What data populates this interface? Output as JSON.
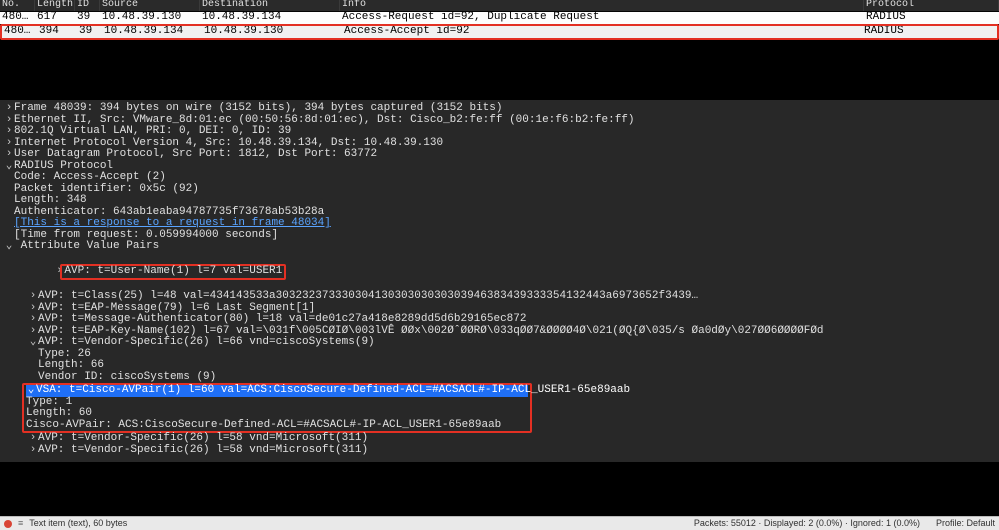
{
  "columns": {
    "no": "No.",
    "length": "Length",
    "id": "ID",
    "source": "Source",
    "destination": "Destination",
    "info": "Info",
    "protocol": "Protocol"
  },
  "packets": [
    {
      "no": "480…",
      "length": "617",
      "id": "39",
      "source": "10.48.39.130",
      "destination": "10.48.39.134",
      "info": "Access-Request id=92, Duplicate Request",
      "protocol": "RADIUS"
    },
    {
      "no": "480…",
      "length": "394",
      "id": "39",
      "source": "10.48.39.134",
      "destination": "10.48.39.130",
      "info": "Access-Accept id=92",
      "protocol": "RADIUS"
    }
  ],
  "details": {
    "frame": "Frame 48039: 394 bytes on wire (3152 bits), 394 bytes captured (3152 bits)",
    "eth": "Ethernet II, Src: VMware_8d:01:ec (00:50:56:8d:01:ec), Dst: Cisco_b2:fe:ff (00:1e:f6:b2:fe:ff)",
    "vlan": "802.1Q Virtual LAN, PRI: 0, DEI: 0, ID: 39",
    "ip": "Internet Protocol Version 4, Src: 10.48.39.134, Dst: 10.48.39.130",
    "udp": "User Datagram Protocol, Src Port: 1812, Dst Port: 63772",
    "radius": "RADIUS Protocol",
    "code": "Code: Access-Accept (2)",
    "pktid": "Packet identifier: 0x5c (92)",
    "length": "Length: 348",
    "auth": "Authenticator: 643ab1eaba94787735f73678ab53b28a",
    "resp_link": "[This is a response to a request in frame 48034]",
    "time": "[Time from request: 0.059994000 seconds]",
    "avp_header": "Attribute Value Pairs",
    "avp_user": "AVP: t=User-Name(1) l=7 val=USER1",
    "avp_class": "AVP: t=Class(25) l=48 val=434143533a30323237333030413030303030303946383439333354132443a6973652f3439…",
    "avp_eapmsg": "AVP: t=EAP-Message(79) l=6 Last Segment[1]",
    "avp_msgauth": "AVP: t=Message-Authenticator(80) l=18 val=de01c27a418e8289dd5d6b29165ec872",
    "avp_eapkey": "AVP: t=EAP-Key-Name(102) l=67 val=",
    "avp_eapkey_suffix": "\\031f\\005CØIØ\\003lVÊ ØØx\\002ØˆØØRØ\\033qØØ7&ØØØØ4Ø\\021(ØQ{Ø\\035/s Øa0dØy\\027ØØ6ØØØØFØd",
    "avp_vsa_cisco": "AVP: t=Vendor-Specific(26) l=66 vnd=ciscoSystems(9)",
    "vsa_type": "Type: 26",
    "vsa_len": "Length: 66",
    "vsa_vendor_pre": "Vendor ID: ",
    "vsa_vendor_link": "ciscoSystems (9)",
    "vsa_line": "VSA: t=Cisco-AVPair(1) l=60 val=ACS:CiscoSecure-Defined-ACL=#ACSACL#-IP-ACL_USER1-65e89aab",
    "vsa_t": "Type: 1",
    "vsa_l": "Length: 60",
    "vsa_avp": "Cisco-AVPair: ACS:CiscoSecure-Defined-ACL=#ACSACL#-IP-ACL_USER1-65e89aab",
    "avp_ms1": "AVP: t=Vendor-Specific(26) l=58 vnd=Microsoft(311)",
    "avp_ms2": "AVP: t=Vendor-Specific(26) l=58 vnd=Microsoft(311)"
  },
  "status": {
    "left": "Text item (text), 60 bytes",
    "right1": "Packets: 55012 · Displayed: 2 (0.0%) · Ignored: 1 (0.0%)",
    "right2": "Profile: Default"
  }
}
